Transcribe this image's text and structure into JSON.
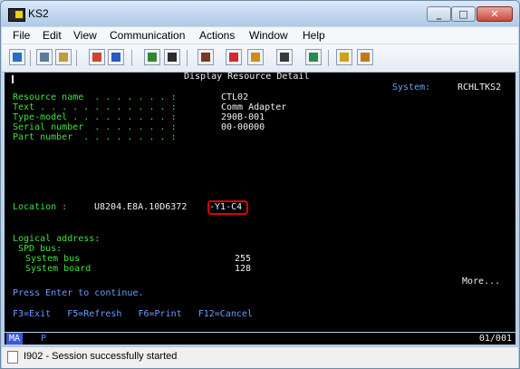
{
  "window": {
    "title": "KS2"
  },
  "menu": [
    "File",
    "Edit",
    "View",
    "Communication",
    "Actions",
    "Window",
    "Help"
  ],
  "toolbar": {
    "buttons": [
      {
        "name": "print-screen-icon",
        "color": "#2a6dbf"
      },
      {
        "name": "copy-icon",
        "color": "#5a7a9a"
      },
      {
        "name": "paste-icon",
        "color": "#c49a3a"
      },
      {
        "name": "send-file-icon",
        "color": "#d0462a"
      },
      {
        "name": "receive-file-icon",
        "color": "#2a5ac0"
      },
      {
        "name": "display-icon",
        "color": "#2b8a2b"
      },
      {
        "name": "keyboard-icon",
        "color": "#2b2b2b"
      },
      {
        "name": "record-macro-icon",
        "color": "#7a3a1a"
      },
      {
        "name": "play-macro-icon",
        "color": "#d02a2a"
      },
      {
        "name": "stop-macro-icon",
        "color": "#d08a1a"
      },
      {
        "name": "quick-keys-icon",
        "color": "#3a3a3a"
      },
      {
        "name": "globe-icon",
        "color": "#2a8a4a"
      },
      {
        "name": "help-icon",
        "color": "#d0a01a"
      }
    ]
  },
  "screen": {
    "title": "Display Resource Detail",
    "system_label": "System:",
    "system_value": "RCHLTKS2",
    "fields": [
      {
        "label": "Resource name  . . . . . . . :",
        "value": "CTL02"
      },
      {
        "label": "Text . . . . . . . . . . . . :",
        "value": "Comm Adapter"
      },
      {
        "label": "Type-model . . . . . . . . . :",
        "value": "290B-001"
      },
      {
        "label": "Serial number  . . . . . . . :",
        "value": "00-00000"
      },
      {
        "label": "Part number  . . . . . . . . :",
        "value": ""
      }
    ],
    "location_label": "Location :",
    "location_value": "U8204.E8A.10D6372",
    "location_highlight": "-Y1-C4",
    "logical_address_label": "Logical address:",
    "spd_bus_label": "SPD bus:",
    "system_bus_label": "System bus",
    "system_bus_value": "255",
    "system_board_label": "System board",
    "system_board_value": "128",
    "more": "More...",
    "prompt": "Press Enter to continue.",
    "function_keys": "F3=Exit   F5=Refresh   F6=Print   F12=Cancel"
  },
  "oia": {
    "mode": "MA",
    "indicator": "P",
    "position": "01/001"
  },
  "status": {
    "message": "I902 - Session successfully started"
  }
}
